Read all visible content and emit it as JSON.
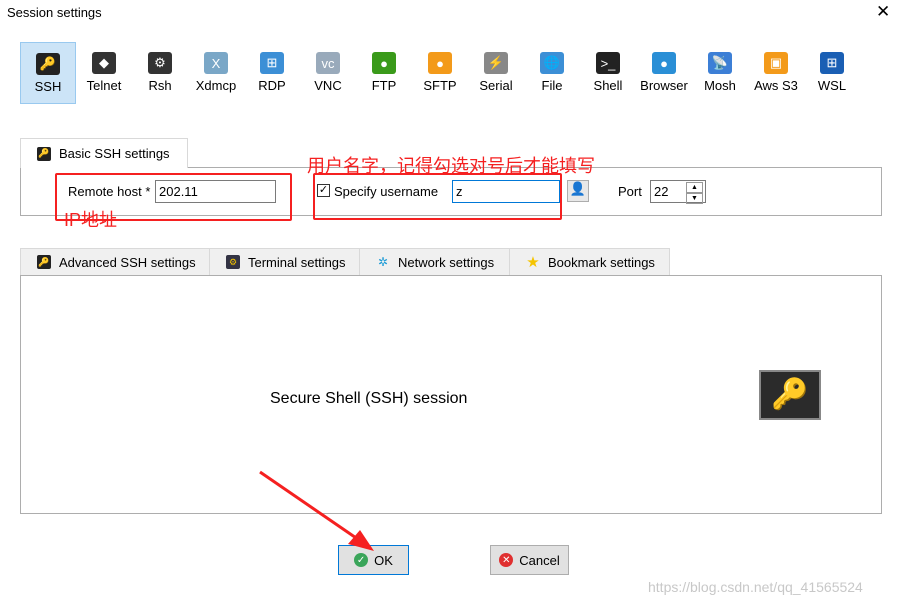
{
  "window": {
    "title": "Session settings",
    "close": "✕"
  },
  "toolbar": [
    {
      "label": "SSH",
      "icon": "key-icon",
      "color": "#222",
      "glyph": "🔑"
    },
    {
      "label": "Telnet",
      "icon": "gem-icon",
      "color": "#333",
      "glyph": "◆"
    },
    {
      "label": "Rsh",
      "icon": "gears-icon",
      "color": "#333",
      "glyph": "⚙"
    },
    {
      "label": "Xdmcp",
      "icon": "x-monitor-icon",
      "color": "#7aa7c7",
      "glyph": "X"
    },
    {
      "label": "RDP",
      "icon": "windows-monitor-icon",
      "color": "#3c8fd6",
      "glyph": "⊞"
    },
    {
      "label": "VNC",
      "icon": "vnc-monitor-icon",
      "color": "#9ab",
      "glyph": "vc"
    },
    {
      "label": "FTP",
      "icon": "green-globe-icon",
      "color": "#3a9a1a",
      "glyph": "●"
    },
    {
      "label": "SFTP",
      "icon": "orange-globe-icon",
      "color": "#f39a1a",
      "glyph": "●"
    },
    {
      "label": "Serial",
      "icon": "plug-icon",
      "color": "#888",
      "glyph": "⚡"
    },
    {
      "label": "File",
      "icon": "file-monitor-icon",
      "color": "#3c8fd6",
      "glyph": "🌐"
    },
    {
      "label": "Shell",
      "icon": "terminal-icon",
      "color": "#222",
      "glyph": ">_"
    },
    {
      "label": "Browser",
      "icon": "globe-icon",
      "color": "#2a8fd6",
      "glyph": "●"
    },
    {
      "label": "Mosh",
      "icon": "satellite-icon",
      "color": "#3c7fd6",
      "glyph": "📡"
    },
    {
      "label": "Aws S3",
      "icon": "aws-cubes-icon",
      "color": "#f39a1a",
      "glyph": "▣"
    },
    {
      "label": "WSL",
      "icon": "windows-icon",
      "color": "#1a5fb4",
      "glyph": "⊞"
    }
  ],
  "basic": {
    "tab": "Basic SSH settings",
    "remote_host_label": "Remote host *",
    "remote_host_value": "202.11",
    "specify_username_label": "Specify username",
    "specify_username_checked": true,
    "username_value": "z",
    "port_label": "Port",
    "port_value": "22"
  },
  "annotations": {
    "username_note": "用户名字，记得勾选对号后才能填写",
    "ip_note": "IP地址"
  },
  "tabs": [
    "Advanced SSH settings",
    "Terminal settings",
    "Network settings",
    "Bookmark settings"
  ],
  "main": {
    "description": "Secure Shell (SSH) session"
  },
  "buttons": {
    "ok": "OK",
    "cancel": "Cancel"
  },
  "watermark": "https://blog.csdn.net/qq_41565524"
}
